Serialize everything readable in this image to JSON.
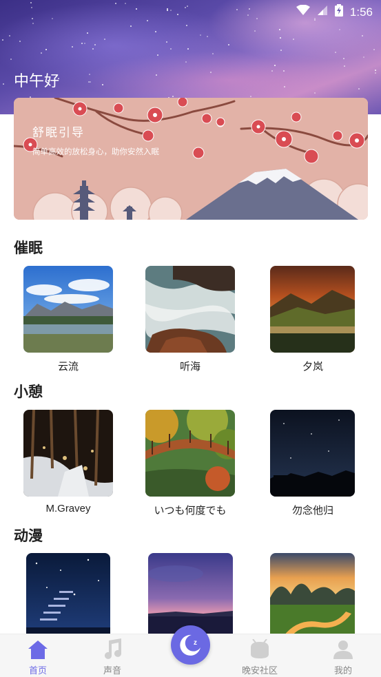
{
  "status": {
    "time": "1:56",
    "icons": [
      "wifi-icon",
      "signal-icon",
      "battery-icon"
    ]
  },
  "header": {
    "greeting": "中午好"
  },
  "banner": {
    "title": "舒眠引导",
    "subtitle": "简单高效的放松身心，助你安然入眠"
  },
  "sections": [
    {
      "title": "催眠",
      "items": [
        {
          "label": "云流"
        },
        {
          "label": "听海"
        },
        {
          "label": "夕岚"
        }
      ]
    },
    {
      "title": "小憩",
      "items": [
        {
          "label": "M.Gravey"
        },
        {
          "label": "いつも何度でも"
        },
        {
          "label": "勿念他归"
        }
      ]
    },
    {
      "title": "动漫",
      "items": [
        {
          "label": ""
        },
        {
          "label": ""
        },
        {
          "label": ""
        }
      ]
    }
  ],
  "tabbar": {
    "tabs": [
      {
        "label": "首页",
        "icon": "home-icon",
        "active": true
      },
      {
        "label": "声音",
        "icon": "music-note-icon",
        "active": false
      },
      {
        "label": "",
        "icon": "moon-sleep-icon",
        "active": false
      },
      {
        "label": "晚安社区",
        "icon": "community-icon",
        "active": false
      },
      {
        "label": "我的",
        "icon": "profile-icon",
        "active": false
      }
    ]
  },
  "colors": {
    "accent": "#6b69e3",
    "banner_bg": "#e4b3a9",
    "tab_inactive": "#888888"
  }
}
